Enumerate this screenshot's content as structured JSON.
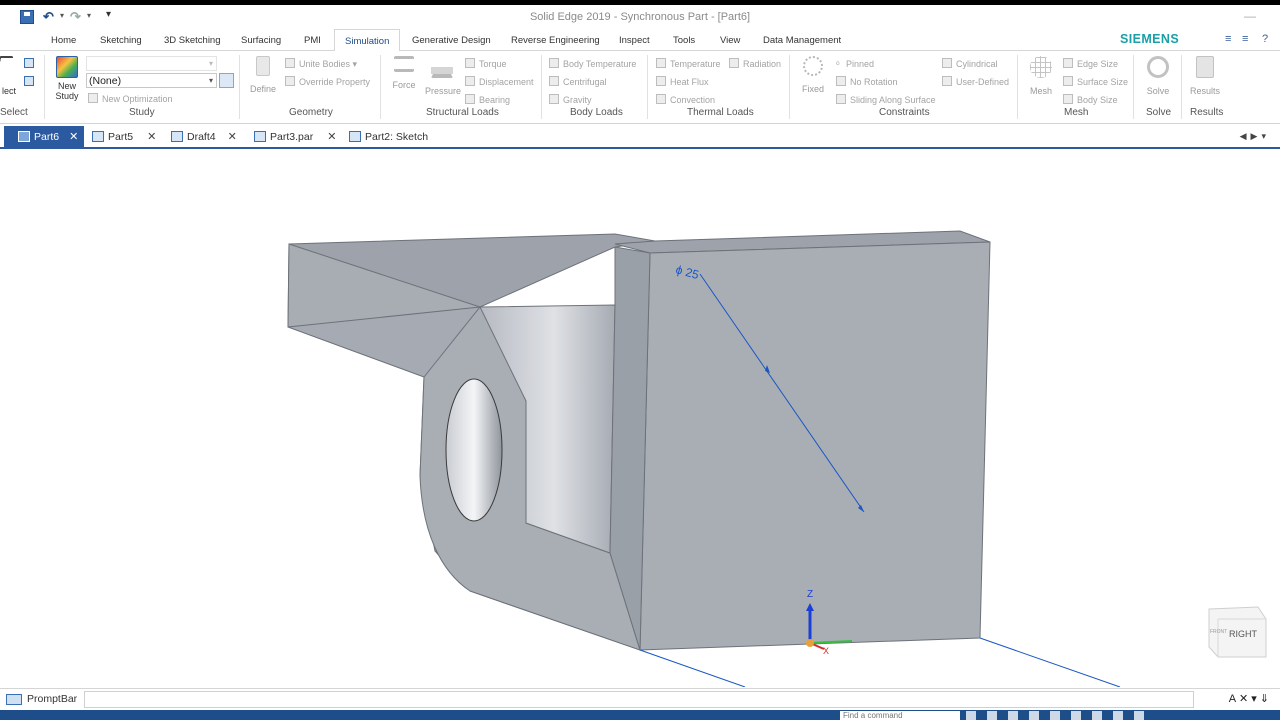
{
  "window": {
    "title": "Solid Edge 2019 - Synchronous Part - [Part6]"
  },
  "quick_access": {
    "save": "save-icon",
    "undo": "undo-icon",
    "redo": "redo-icon",
    "customize": "▾"
  },
  "ribbon_tabs": [
    {
      "label": "Home"
    },
    {
      "label": "Sketching"
    },
    {
      "label": "3D Sketching"
    },
    {
      "label": "Surfacing"
    },
    {
      "label": "PMI"
    },
    {
      "label": "Simulation",
      "active": true
    },
    {
      "label": "Generative Design"
    },
    {
      "label": "Reverse Engineering"
    },
    {
      "label": "Inspect"
    },
    {
      "label": "Tools"
    },
    {
      "label": "View"
    },
    {
      "label": "Data Management"
    }
  ],
  "brand": "SIEMENS",
  "ribbon": {
    "select": {
      "label": "lect",
      "group": "Select"
    },
    "study": {
      "new_study": "New Study",
      "study_type": "",
      "study_value": "(None)",
      "new_optimization": "New Optimization",
      "group": "Study"
    },
    "geometry": {
      "define": "Define",
      "unite_bodies": "Unite Bodies",
      "override_property": "Override Property",
      "group": "Geometry"
    },
    "structural_loads": {
      "force": "Force",
      "pressure": "Pressure",
      "torque": "Torque",
      "displacement": "Displacement",
      "bearing": "Bearing",
      "group": "Structural Loads"
    },
    "body_loads": {
      "body_temperature": "Body Temperature",
      "centrifugal": "Centrifugal",
      "gravity": "Gravity",
      "group": "Body Loads"
    },
    "thermal_loads": {
      "temperature": "Temperature",
      "radiation": "Radiation",
      "heat_flux": "Heat Flux",
      "convection": "Convection",
      "group": "Thermal Loads"
    },
    "constraints": {
      "fixed": "Fixed",
      "pinned": "Pinned",
      "no_rotation": "No Rotation",
      "sliding_along_surface": "Sliding Along Surface",
      "cylindrical": "Cylindrical",
      "user_defined": "User-Defined",
      "group": "Constraints"
    },
    "mesh": {
      "mesh": "Mesh",
      "edge_size": "Edge Size",
      "surface_size": "Surface Size",
      "body_size": "Body Size",
      "group": "Mesh"
    },
    "solve": {
      "solve": "Solve",
      "group": "Solve"
    },
    "results": {
      "results": "Results",
      "group": "Results"
    }
  },
  "document_tabs": [
    {
      "label": "Part6",
      "active": true
    },
    {
      "label": "Part5"
    },
    {
      "label": "Draft4"
    },
    {
      "label": "Part3.par"
    },
    {
      "label": "Part2: Sketch"
    }
  ],
  "viewport": {
    "dimension_label": "ϕ 25",
    "triad": {
      "z": "Z",
      "x": "X"
    },
    "view_cube": {
      "right": "RIGHT",
      "front": "FRONT"
    }
  },
  "prompt_bar": {
    "label": "PromptBar",
    "value": ""
  },
  "status_bar": {
    "command_placeholder": "Find a command"
  },
  "colors": {
    "accent": "#2c5aa0",
    "brand": "#1aa0a6",
    "status_bar": "#1d4e89",
    "part_face": "#a9afb8"
  }
}
